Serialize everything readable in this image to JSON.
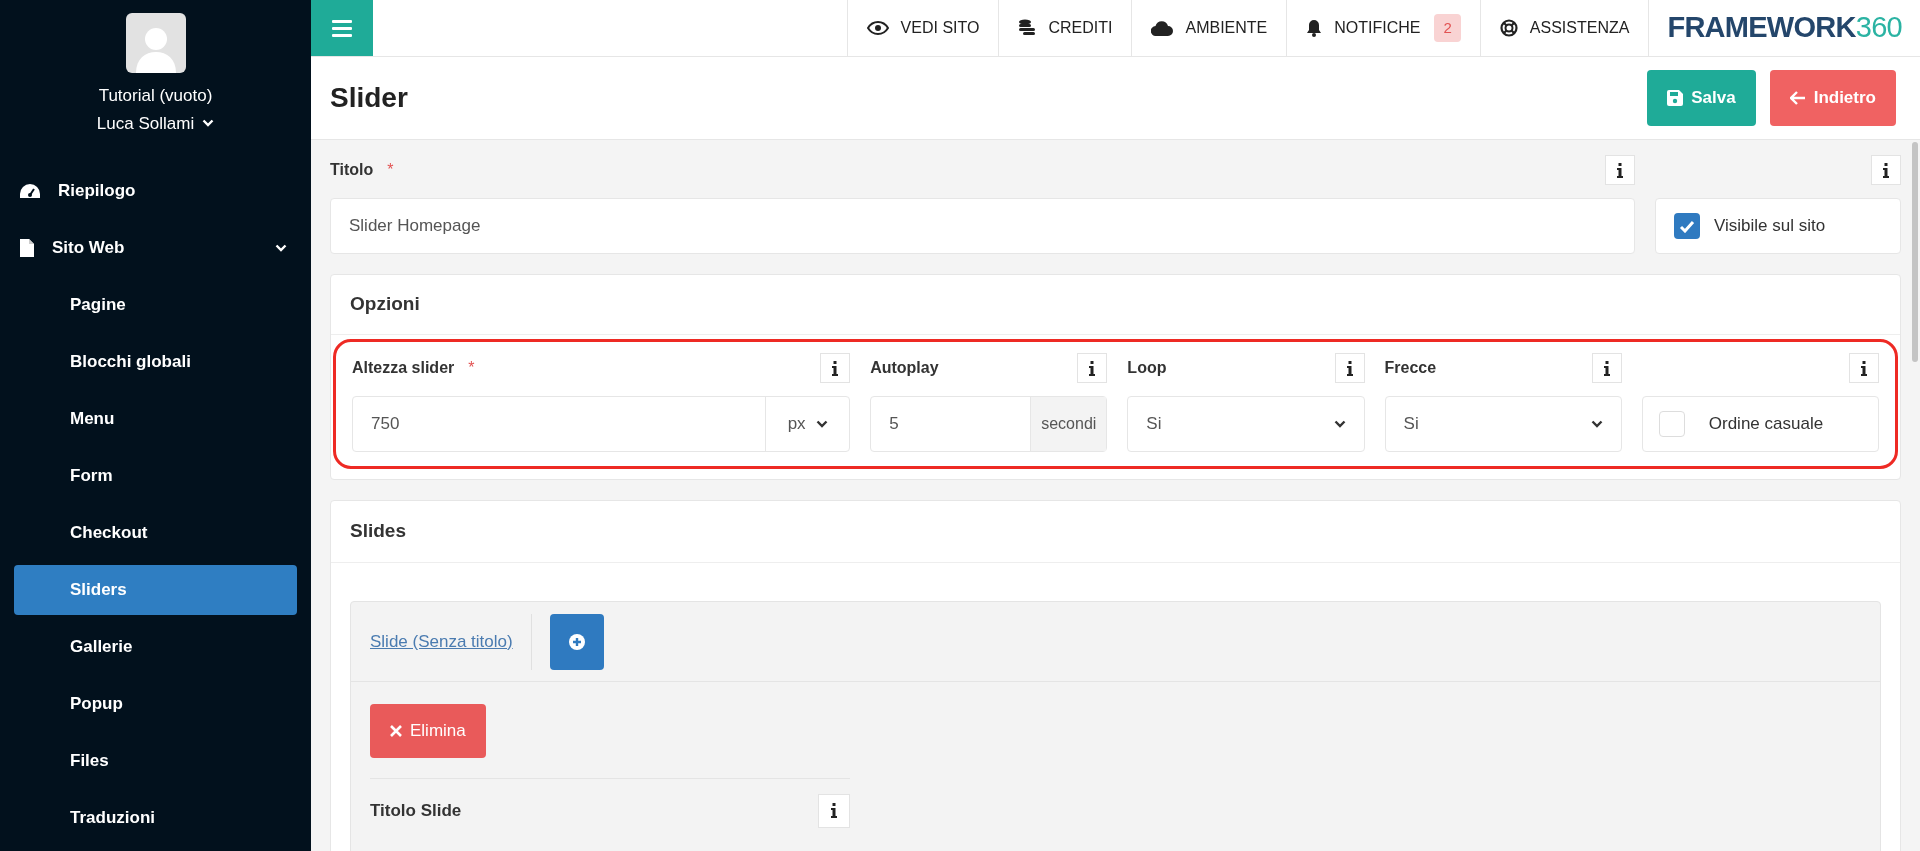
{
  "sidebar": {
    "profile": {
      "workspace": "Tutorial (vuoto)",
      "user": "Luca Sollami"
    },
    "items": [
      {
        "label": "Riepilogo",
        "selected": false
      },
      {
        "label": "Sito Web",
        "selected": false,
        "expanded": true,
        "children": [
          {
            "label": "Pagine",
            "selected": false
          },
          {
            "label": "Blocchi globali",
            "selected": false
          },
          {
            "label": "Menu",
            "selected": false
          },
          {
            "label": "Form",
            "selected": false
          },
          {
            "label": "Checkout",
            "selected": false
          },
          {
            "label": "Sliders",
            "selected": true
          },
          {
            "label": "Gallerie",
            "selected": false
          },
          {
            "label": "Popup",
            "selected": false
          },
          {
            "label": "Files",
            "selected": false
          },
          {
            "label": "Traduzioni",
            "selected": false
          }
        ]
      }
    ]
  },
  "topbar": {
    "nav": [
      {
        "label": "VEDI SITO"
      },
      {
        "label": "CREDITI"
      },
      {
        "label": "AMBIENTE"
      },
      {
        "label": "NOTIFICHE",
        "badge": "2"
      },
      {
        "label": "ASSISTENZA"
      }
    ],
    "logo": {
      "word": "FRAMEWORK",
      "number": "360"
    }
  },
  "page": {
    "title": "Slider",
    "buttons": [
      {
        "label": "Salva",
        "kind": "save"
      },
      {
        "label": "Indietro",
        "kind": "back"
      }
    ]
  },
  "title_field": {
    "label": "Titolo",
    "required_mark": "*",
    "value": "Slider Homepage"
  },
  "visible": {
    "label": "Visibile sul sito",
    "checked": true
  },
  "options": {
    "heading": "Opzioni",
    "fields": [
      {
        "kind": "number_unit",
        "label": "Altezza slider",
        "required_mark": "*",
        "value": "750",
        "unit": "px"
      },
      {
        "kind": "number_suffix",
        "label": "Autoplay",
        "value": "5",
        "suffix": "secondi"
      },
      {
        "kind": "select",
        "label": "Loop",
        "value": "Si"
      },
      {
        "kind": "select",
        "label": "Frecce",
        "value": "Si"
      },
      {
        "kind": "checkbox",
        "label": "Ordine casuale",
        "checked": false
      }
    ]
  },
  "slides": {
    "heading": "Slides",
    "tabs": [
      {
        "label": "Slide (Senza titolo)",
        "selected": true
      }
    ],
    "delete_label": "Elimina",
    "slide_title_label": "Titolo Slide"
  }
}
